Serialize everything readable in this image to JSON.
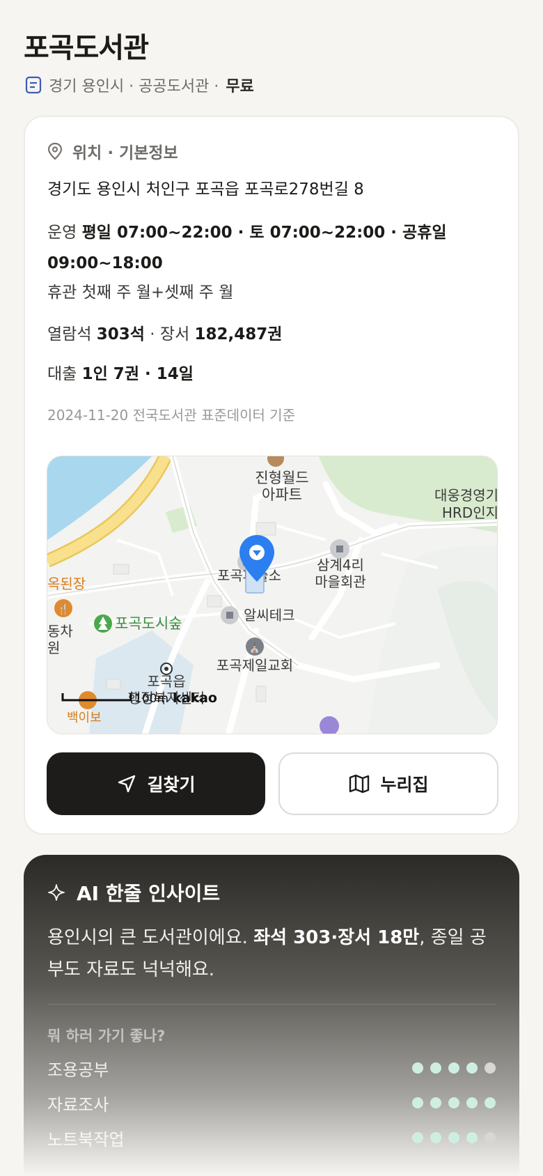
{
  "header": {
    "title": "포곡도서관",
    "meta": "경기 용인시 · 공공도서관 ·",
    "fee": "무료"
  },
  "info": {
    "section_title": "위치 · 기본정보",
    "address": "경기도 용인시 처인구 포곡읍 포곡로278번길 8",
    "hours_label": "운영",
    "hours_value": "평일 07:00~22:00 · 토 07:00~22:00 · 공휴일 09:00~18:00",
    "closed": "휴관 첫째 주 월+셋째 주 월",
    "seats_label": "열람석",
    "seats_value": "303석",
    "books_label": "· 장서",
    "books_value": "182,487권",
    "loan_label": "대출",
    "loan_value": "1인 7권 · 14일",
    "source": "2024-11-20 전국도서관 표준데이터 기준"
  },
  "map": {
    "labels": {
      "apt": "진형월드",
      "apt2": "아파트",
      "hrd": "대웅경영기",
      "hrd2": "HRD인지",
      "police": "포곡파출소",
      "village": "삼계4리",
      "village2": "마을회관",
      "restaurant": "옥된장",
      "forest": "포곡도시숲",
      "left1": "동차",
      "left2": "원",
      "alc": "알씨테크",
      "church": "포곡제일교회",
      "office": "포곡읍",
      "office2": "행정복지센터",
      "scale": "100m",
      "brand": "kakao",
      "bottom": "백이보"
    }
  },
  "actions": {
    "route": "길찾기",
    "website": "누리집"
  },
  "insight": {
    "title": "AI 한줄 인사이트",
    "text_a": "용인시의 큰 도서관이에요. ",
    "text_b": "좌석 303·장서 18만",
    "text_c": ", 종일 공부도 자료도 넉넉해요.",
    "question": "뭐 하러 가기 좋나?",
    "ratings": [
      {
        "label": "조용공부",
        "score": 4,
        "max": 5
      },
      {
        "label": "자료조사",
        "score": 5,
        "max": 5
      },
      {
        "label": "노트북작업",
        "score": 4,
        "max": 5
      }
    ]
  },
  "colors": {
    "accent_dark": "#1d1c1a",
    "pin_blue": "#2b7ff0",
    "dot_on": "#cfeee3",
    "dot_off": "#d7d7d5"
  }
}
